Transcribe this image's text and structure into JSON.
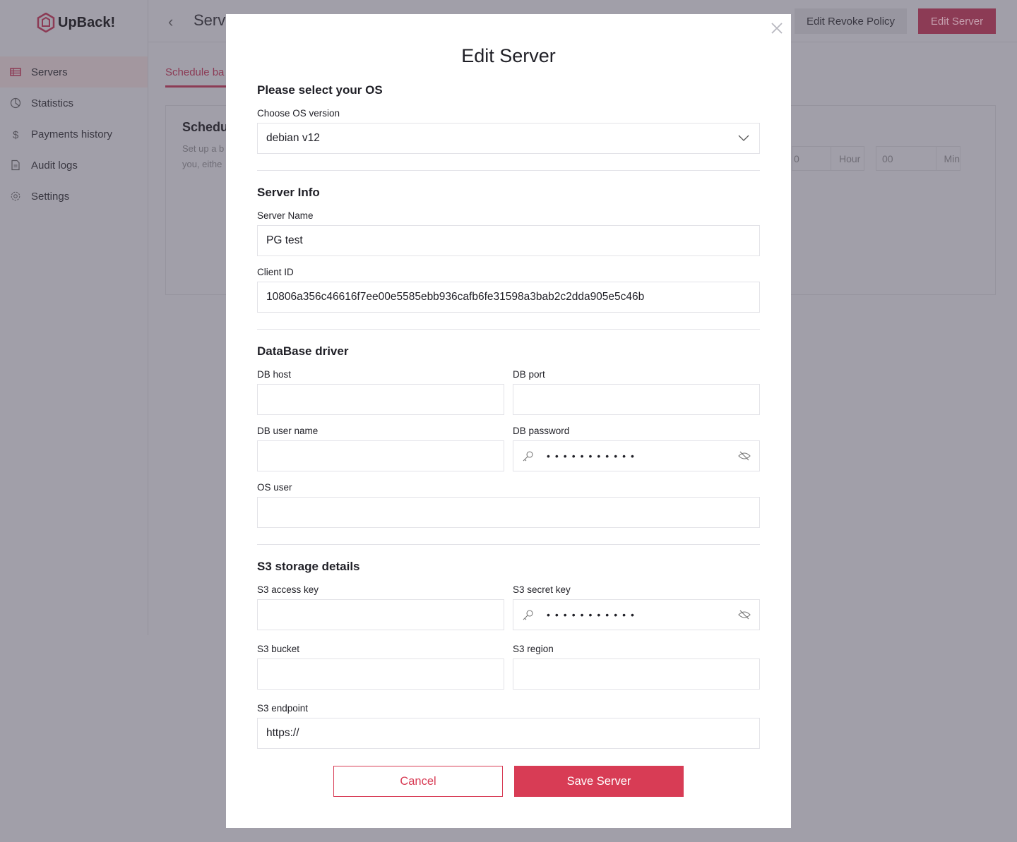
{
  "app": {
    "name": "UpBack!"
  },
  "sidebar": {
    "items": [
      {
        "label": "Servers"
      },
      {
        "label": "Statistics"
      },
      {
        "label": "Payments history"
      },
      {
        "label": "Audit logs"
      },
      {
        "label": "Settings"
      }
    ]
  },
  "header": {
    "title": "Serv",
    "revoke_label": "Edit Revoke Policy",
    "edit_label": "Edit Server"
  },
  "tabs": {
    "schedule": "Schedule ba"
  },
  "card": {
    "title": "Schedu",
    "desc1": "Set up a b",
    "desc2": "you, eithe",
    "hour_value": "0",
    "hour_unit": "Hour",
    "min_value": "00",
    "min_unit": "Min"
  },
  "modal": {
    "title": "Edit Server",
    "os": {
      "section": "Please select your OS",
      "label": "Choose OS version",
      "value": "debian v12"
    },
    "server": {
      "section": "Server Info",
      "name_label": "Server Name",
      "name_value": "PG test",
      "client_label": "Client ID",
      "client_value": "10806a356c46616f7ee00e5585ebb936cafb6fe31598a3bab2c2dda905e5c46b"
    },
    "db": {
      "section": "DataBase driver",
      "host_label": "DB host",
      "port_label": "DB port",
      "user_label": "DB user name",
      "password_label": "DB password",
      "password_mask": "•••••••••••",
      "os_user_label": "OS user"
    },
    "s3": {
      "section": "S3 storage details",
      "access_label": "S3 access key",
      "secret_label": "S3 secret key",
      "secret_mask": "•••••••••••",
      "bucket_label": "S3 bucket",
      "region_label": "S3 region",
      "endpoint_label": "S3 endpoint",
      "endpoint_value": "https://"
    },
    "cancel_label": "Cancel",
    "save_label": "Save Server"
  },
  "colors": {
    "accent": "#d83c55",
    "overlay": "#a19fa9"
  }
}
